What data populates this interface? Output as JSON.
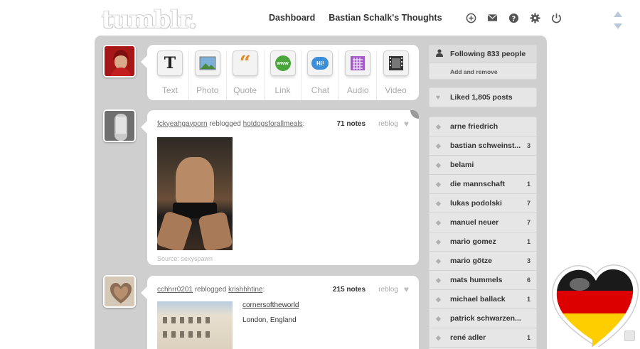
{
  "header": {
    "logo": "tumblr.",
    "nav": [
      "Dashboard",
      "Bastian Schalk's Thoughts"
    ],
    "icons": [
      "plus-circle-icon",
      "mail-icon",
      "help-icon",
      "gear-icon",
      "power-icon"
    ]
  },
  "post_types": [
    {
      "label": "Text",
      "icon": "T"
    },
    {
      "label": "Photo",
      "icon": "photo-icon"
    },
    {
      "label": "Quote",
      "icon": "quote-icon"
    },
    {
      "label": "Link",
      "icon": "www"
    },
    {
      "label": "Chat",
      "icon": "Hi!"
    },
    {
      "label": "Audio",
      "icon": "audio-icon"
    },
    {
      "label": "Video",
      "icon": "video-icon"
    }
  ],
  "posts": [
    {
      "user": "fckyeahgayporn",
      "action": "reblogged",
      "source_user": "hotdogsforallmeals",
      "notes": "71 notes",
      "reblog": "reblog",
      "source": "Source: sexyspawn"
    },
    {
      "user": "cchhrr0201",
      "action": "reblogged",
      "source_user": "krishhhtine",
      "notes": "215 notes",
      "reblog": "reblog",
      "link_title": "cornersoftheworld",
      "location": "London, England"
    }
  ],
  "sidebar": {
    "following": "Following 833 people",
    "add_remove": "Add and remove",
    "liked": "Liked 1,805 posts",
    "tags": [
      {
        "name": "arne friedrich",
        "count": ""
      },
      {
        "name": "bastian schweinst...",
        "count": "3"
      },
      {
        "name": "belami",
        "count": ""
      },
      {
        "name": "die mannschaft",
        "count": "1"
      },
      {
        "name": "lukas podolski",
        "count": "7"
      },
      {
        "name": "manuel neuer",
        "count": "7"
      },
      {
        "name": "mario gomez",
        "count": "1"
      },
      {
        "name": "mario götze",
        "count": "3"
      },
      {
        "name": "mats hummels",
        "count": "6"
      },
      {
        "name": "michael ballack",
        "count": "1"
      },
      {
        "name": "patrick schwarzen...",
        "count": ""
      },
      {
        "name": "rené adler",
        "count": "1"
      }
    ]
  },
  "colors": {
    "container": "#cfcfcf",
    "flag_black": "#000000",
    "flag_red": "#dd0000",
    "flag_gold": "#ffce00"
  }
}
